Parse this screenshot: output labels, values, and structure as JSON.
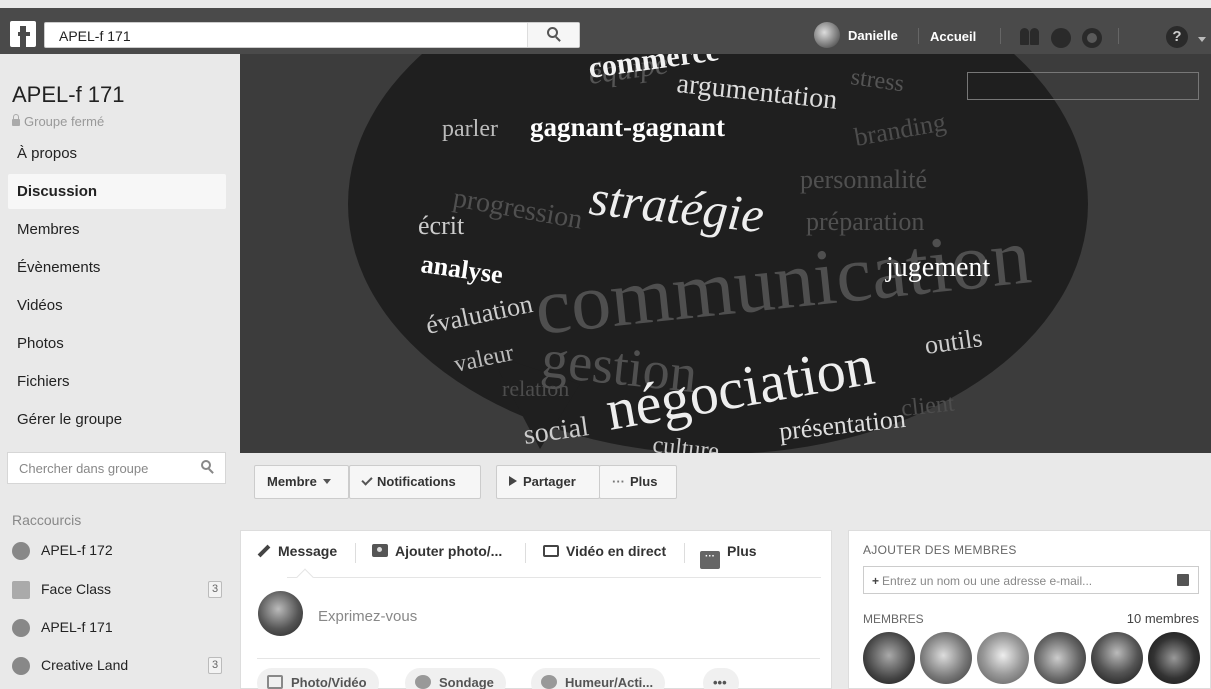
{
  "topbar": {
    "search_value": "APEL-f 171",
    "user_name": "Danielle",
    "home_label": "Accueil",
    "help_symbol": "?"
  },
  "group": {
    "name": "APEL-f 171",
    "type": "Groupe fermé"
  },
  "nav": {
    "items": [
      {
        "label": "À propos"
      },
      {
        "label": "Discussion"
      },
      {
        "label": "Membres"
      },
      {
        "label": "Évènements"
      },
      {
        "label": "Vidéos"
      },
      {
        "label": "Photos"
      },
      {
        "label": "Fichiers"
      },
      {
        "label": "Gérer le groupe"
      }
    ],
    "active_index": 1
  },
  "side_search": {
    "placeholder": "Chercher dans groupe"
  },
  "shortcuts": {
    "title": "Raccourcis",
    "items": [
      {
        "label": "APEL-f 172",
        "badge": ""
      },
      {
        "label": "Face Class",
        "badge": "3"
      },
      {
        "label": "APEL-f 171",
        "badge": ""
      },
      {
        "label": "Creative Land",
        "badge": "3"
      }
    ]
  },
  "cover": {
    "words": [
      {
        "text": "commerce"
      },
      {
        "text": "équipe"
      },
      {
        "text": "argumentation"
      },
      {
        "text": "stress"
      },
      {
        "text": "parler"
      },
      {
        "text": "gagnant-gagnant"
      },
      {
        "text": "branding"
      },
      {
        "text": "personnalité"
      },
      {
        "text": "progression"
      },
      {
        "text": "stratégie"
      },
      {
        "text": "écrit"
      },
      {
        "text": "préparation"
      },
      {
        "text": "communication"
      },
      {
        "text": "analyse"
      },
      {
        "text": "jugement"
      },
      {
        "text": "évaluation"
      },
      {
        "text": "gestion"
      },
      {
        "text": "outils"
      },
      {
        "text": "valeur"
      },
      {
        "text": "relation"
      },
      {
        "text": "négociation"
      },
      {
        "text": "social"
      },
      {
        "text": "présentation"
      },
      {
        "text": "client"
      },
      {
        "text": "culture"
      }
    ]
  },
  "actions": {
    "member": "Membre",
    "notifications": "Notifications",
    "share": "Partager",
    "more": "Plus"
  },
  "composer": {
    "tabs": {
      "message": "Message",
      "photo": "Ajouter photo/...",
      "live": "Vidéo en direct",
      "more": "Plus"
    },
    "placeholder": "Exprimez-vous",
    "pills": {
      "photo": "Photo/Vidéo",
      "poll": "Sondage",
      "mood": "Humeur/Acti...",
      "more": "•••"
    }
  },
  "add_members": {
    "title": "AJOUTER DES MEMBRES",
    "plus": "+",
    "placeholder": "Entrez un nom ou une adresse e-mail...",
    "members_label": "MEMBRES",
    "members_count": "10 membres"
  }
}
